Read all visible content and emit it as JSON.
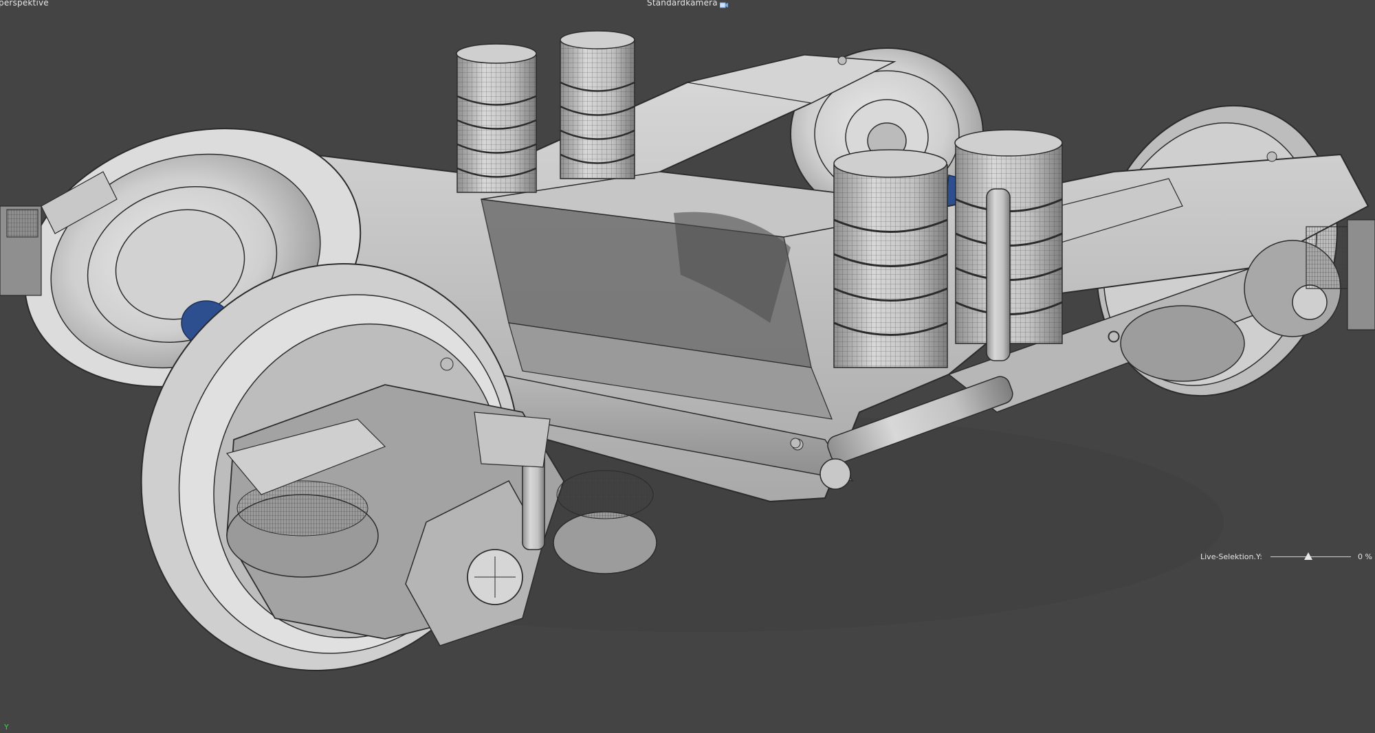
{
  "viewport": {
    "left_label": "zentralperspektive",
    "camera_label": "Standardkamera",
    "camera_icon": "camera-icon",
    "background": "#444444"
  },
  "model": {
    "mesh_color": "#d7d7d7",
    "wire_color": "#2b2b2b",
    "axle_color": "#2d4f8f"
  },
  "hud": {
    "label": "Live-Selektion.Y:",
    "value_text": "0 %",
    "value_fraction": 0.0,
    "thumb_color": "#e8e8e8"
  },
  "axis": {
    "label": "Y",
    "color": "#3fcf4f"
  }
}
